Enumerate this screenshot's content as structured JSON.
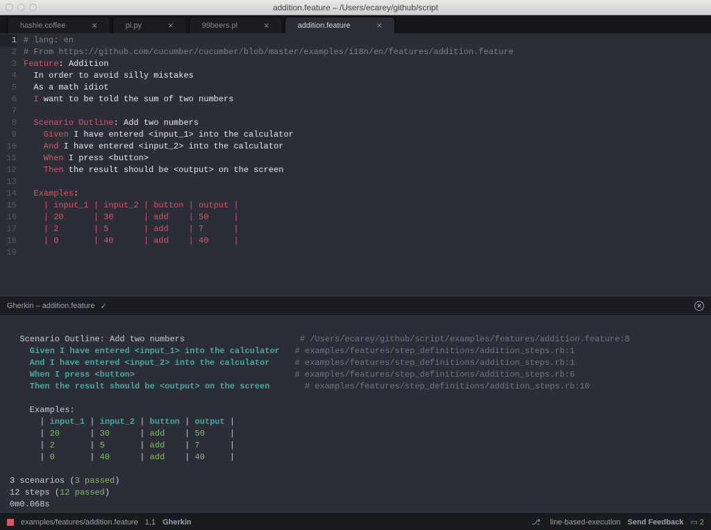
{
  "window": {
    "title": "addition.feature – /Users/ecarey/github/script"
  },
  "tabs": [
    {
      "label": "hashie.coffee",
      "active": false
    },
    {
      "label": "pi.py",
      "active": false
    },
    {
      "label": "99beers.pl",
      "active": false
    },
    {
      "label": "addition.feature",
      "active": true
    }
  ],
  "editor": {
    "line_count": 19,
    "lines": {
      "l1": {
        "comment": "# lang: en"
      },
      "l2": {
        "comment": "# From https://github.com/cucumber/cucumber/blob/master/examples/i18n/en/features/addition.feature"
      },
      "l3": {
        "key": "Feature",
        "rest": ": Addition"
      },
      "l4": {
        "text": "  In order to avoid silly mistakes"
      },
      "l5": {
        "text": "  As a math idiot"
      },
      "l6": {
        "key": "  I",
        "rest": " want to be told the sum of two numbers"
      },
      "l8": {
        "key": "  Scenario Outline",
        "rest": ": Add two numbers"
      },
      "l9": {
        "key": "    Given",
        "rest": " I have entered <input_1> into the calculator"
      },
      "l10": {
        "key": "    And",
        "rest": " I have entered <input_2> into the calculator"
      },
      "l11": {
        "key": "    When",
        "rest": " I press <button>"
      },
      "l12": {
        "key": "    Then",
        "rest": " the result should be <output> on the screen"
      },
      "l14": {
        "key": "  Examples",
        "rest": ":"
      },
      "l15": {
        "table": "    | input_1 | input_2 | button | output |"
      },
      "l16": {
        "table": "    | 20      | 30      | add    | 50     |"
      },
      "l17": {
        "table": "    | 2       | 5       | add    | 7      |"
      },
      "l18": {
        "table": "    | 0       | 40      | add    | 40     |"
      }
    }
  },
  "panel": {
    "title": "Gherkin – addition.feature"
  },
  "output": {
    "scenario_head": "  Scenario Outline: Add two numbers",
    "scenario_loc": "# /Users/ecarey/github/script/examples/features/addition.feature:8",
    "step1": "    Given I have entered <input_1> into the calculator",
    "step1_loc": "# examples/features/step_definitions/addition_steps.rb:1",
    "step2": "    And I have entered <input_2> into the calculator",
    "step2_loc": "# examples/features/step_definitions/addition_steps.rb:1",
    "step3": "    When I press <button>",
    "step3_loc": "# examples/features/step_definitions/addition_steps.rb:6",
    "step4": "    Then the result should be <output> on the screen",
    "step4_loc": "# examples/features/step_definitions/addition_steps.rb:10",
    "examples_label": "    Examples:",
    "tbl_head_p": "      | ",
    "h1": "input_1",
    "h2": "input_2",
    "h3": "button",
    "h4": "output",
    "sep": " | ",
    "end": " |",
    "r1c1": "20     ",
    "r1c2": "30     ",
    "r1c3": "add   ",
    "r1c4": "50    ",
    "r2c1": "2      ",
    "r2c2": "5      ",
    "r2c3": "add   ",
    "r2c4": "7     ",
    "r3c1": "0      ",
    "r3c2": "40     ",
    "r3c3": "add   ",
    "r3c4": "40    ",
    "sum_scen_a": "3 scenarios (",
    "sum_scen_b": "3 passed",
    "sum_scen_c": ")",
    "sum_step_a": "12 steps (",
    "sum_step_b": "12 passed",
    "sum_step_c": ")",
    "time": "0m0.068s"
  },
  "status": {
    "path": "examples/features/addition.feature",
    "cursor": "1,1",
    "lang": "Gherkin",
    "branch": "line-based-execution",
    "feedback": "Send Feedback",
    "notif": "2"
  }
}
